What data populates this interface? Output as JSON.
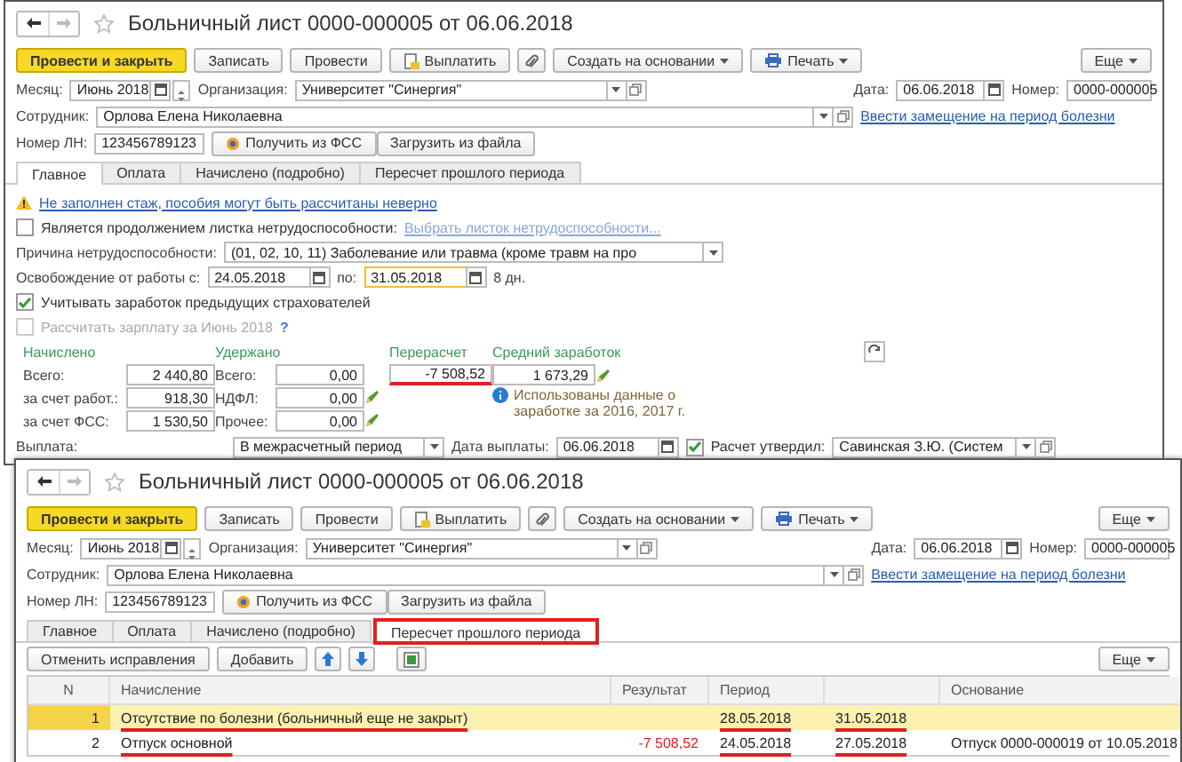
{
  "top_window": {
    "title": "Больничный лист 0000-000005 от 06.06.2018",
    "toolbar": [
      {
        "label": "Провести и закрыть",
        "kind": "primary"
      },
      {
        "label": "Записать",
        "kind": "plain"
      },
      {
        "label": "Провести",
        "kind": "plain"
      },
      {
        "label": "Выплатить",
        "kind": "pay"
      },
      {
        "kind": "clip"
      },
      {
        "label": "Создать на основании",
        "kind": "menu"
      },
      {
        "label": "Печать",
        "kind": "print"
      }
    ],
    "more": "Еще",
    "month_label": "Месяц:",
    "month": "Июнь 2018",
    "org_label": "Организация:",
    "org": "Университет \"Синергия\"",
    "date_label": "Дата:",
    "date": "06.06.2018",
    "number_label": "Номер:",
    "number": "0000-000005",
    "employee_label": "Сотрудник:",
    "employee": "Орлова Елена Николаевна",
    "replacement_link": "Ввести замещение на период болезни",
    "ln_label": "Номер ЛН:",
    "ln": "123456789123",
    "fss_button": "Получить из ФСС",
    "file_button": "Загрузить из файла",
    "tabs": [
      {
        "label": "Главное",
        "selected": true,
        "marked": false
      },
      {
        "label": "Оплата",
        "selected": false,
        "marked": false
      },
      {
        "label": "Начислено (подробно)",
        "selected": false,
        "marked": false
      },
      {
        "label": "Пересчет прошлого периода",
        "selected": false,
        "marked": false
      }
    ],
    "main": {
      "warning": "Не заполнен стаж, пособия могут быть рассчитаны неверно",
      "continuation": {
        "label": "Является продолжением листка нетрудоспособности:",
        "checked": false,
        "link": "Выбрать листок нетрудоспособности..."
      },
      "reason_label": "Причина нетрудоспособности:",
      "reason": "(01, 02, 10, 11) Заболевание или травма (кроме травм на про",
      "release_label": "Освобождение от работы с:",
      "release_from": "24.05.2018",
      "release_to_label": "по:",
      "release_to": "31.05.2018",
      "days": "8 дн.",
      "checkboxes": [
        {
          "label": "Учитывать заработок предыдущих страхователей",
          "checked": true,
          "disabled": false
        },
        {
          "label": "Рассчитать зарплату за Июнь 2018",
          "checked": false,
          "disabled": true
        }
      ],
      "help": "?",
      "accrued": {
        "title": "Начислено",
        "rows": [
          {
            "label": "Всего:",
            "value": "2 440,80"
          },
          {
            "label": "за счет работ.:",
            "value": "918,30"
          },
          {
            "label": "за счет ФСС:",
            "value": "1 530,50"
          }
        ]
      },
      "withheld": {
        "title": "Удержано",
        "rows": [
          {
            "label": "Всего:",
            "value": "0,00",
            "editable": false
          },
          {
            "label": "НДФЛ:",
            "value": "0,00",
            "editable": true
          },
          {
            "label": "Прочее:",
            "value": "0,00",
            "editable": true
          }
        ]
      },
      "recalc": {
        "title": "Перерасчет",
        "value": "-7 508,52",
        "underlined": true
      },
      "average": {
        "title": "Средний заработок",
        "value": "1 673,29"
      },
      "info": "Использованы данные о заработке за 2016,  2017 г.",
      "payment_label": "Выплата:",
      "payment": "В межрасчетный период",
      "pay_date_label": "Дата выплаты:",
      "pay_date": "06.06.2018",
      "approved": {
        "label": "Расчет утвердил:",
        "checked": true
      },
      "approver": "Савинская З.Ю. (Систем"
    }
  },
  "bottom_window": {
    "title": "Больничный лист 0000-000005 от 06.06.2018",
    "toolbar": [
      {
        "label": "Провести и закрыть",
        "kind": "primary"
      },
      {
        "label": "Записать",
        "kind": "plain"
      },
      {
        "label": "Провести",
        "kind": "plain"
      },
      {
        "label": "Выплатить",
        "kind": "pay"
      },
      {
        "kind": "clip"
      },
      {
        "label": "Создать на основании",
        "kind": "menu"
      },
      {
        "label": "Печать",
        "kind": "print"
      }
    ],
    "more": "Еще",
    "month_label": "Месяц:",
    "month": "Июнь 2018",
    "org_label": "Организация:",
    "org": "Университет \"Синергия\"",
    "date_label": "Дата:",
    "date": "06.06.2018",
    "number_label": "Номер:",
    "number": "0000-000005",
    "employee_label": "Сотрудник:",
    "employee": "Орлова Елена Николаевна",
    "replacement_link": "Ввести замещение на период болезни",
    "ln_label": "Номер ЛН:",
    "ln": "123456789123",
    "fss_button": "Получить из ФСС",
    "file_button": "Загрузить из файла",
    "tabs": [
      {
        "label": "Главное",
        "selected": false,
        "marked": false
      },
      {
        "label": "Оплата",
        "selected": false,
        "marked": false
      },
      {
        "label": "Начислено (подробно)",
        "selected": false,
        "marked": false
      },
      {
        "label": "Пересчет прошлого периода",
        "selected": true,
        "marked": true
      }
    ],
    "recalc": {
      "toolbar": [
        {
          "label": "Отменить исправления",
          "kind": "text"
        },
        {
          "label": "Добавить",
          "kind": "text"
        },
        {
          "kind": "up"
        },
        {
          "kind": "down"
        },
        {
          "kind": "excel"
        }
      ],
      "more": "Еще",
      "columns": [
        "N",
        "Начисление",
        "Результат",
        "Период",
        "Основание"
      ],
      "rows": [
        {
          "n": "1",
          "accrual": "Отсутствие по болезни (больничный еще не закрыт)",
          "period_from": "28.05.2018",
          "period_to": "31.05.2018",
          "selected": true,
          "underlined": true,
          "negative": false
        },
        {
          "n": "2",
          "accrual": "Отпуск основной",
          "result": "-7 508,52",
          "period_from": "24.05.2018",
          "period_to": "27.05.2018",
          "basis": "Отпуск 0000-000019 от 10.05.2018",
          "selected": false,
          "underlined": true,
          "negative": true
        }
      ]
    }
  }
}
